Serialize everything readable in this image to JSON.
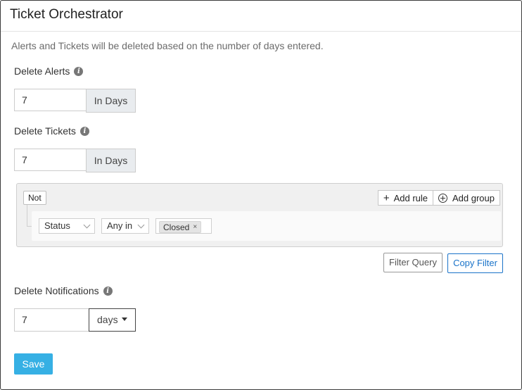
{
  "page": {
    "title": "Ticket Orchestrator",
    "description": "Alerts and Tickets will be deleted based on the number of days entered."
  },
  "delete_alerts": {
    "label": "Delete Alerts",
    "value": "7",
    "addon": "In Days"
  },
  "delete_tickets": {
    "label": "Delete Tickets",
    "value": "7",
    "addon": "In Days"
  },
  "query_builder": {
    "not_label": "Not",
    "add_rule_label": "Add rule",
    "add_group_label": "Add group",
    "rule": {
      "field": "Status",
      "operator": "Any in",
      "values": [
        "Closed"
      ]
    }
  },
  "filter_actions": {
    "filter_query_label": "Filter Query",
    "copy_filter_label": "Copy Filter"
  },
  "delete_notifications": {
    "label": "Delete Notifications",
    "value": "7",
    "unit": "days"
  },
  "save_label": "Save",
  "colors": {
    "primary": "#36b0e4",
    "link": "#1a73c9",
    "info_icon": "#777777"
  }
}
